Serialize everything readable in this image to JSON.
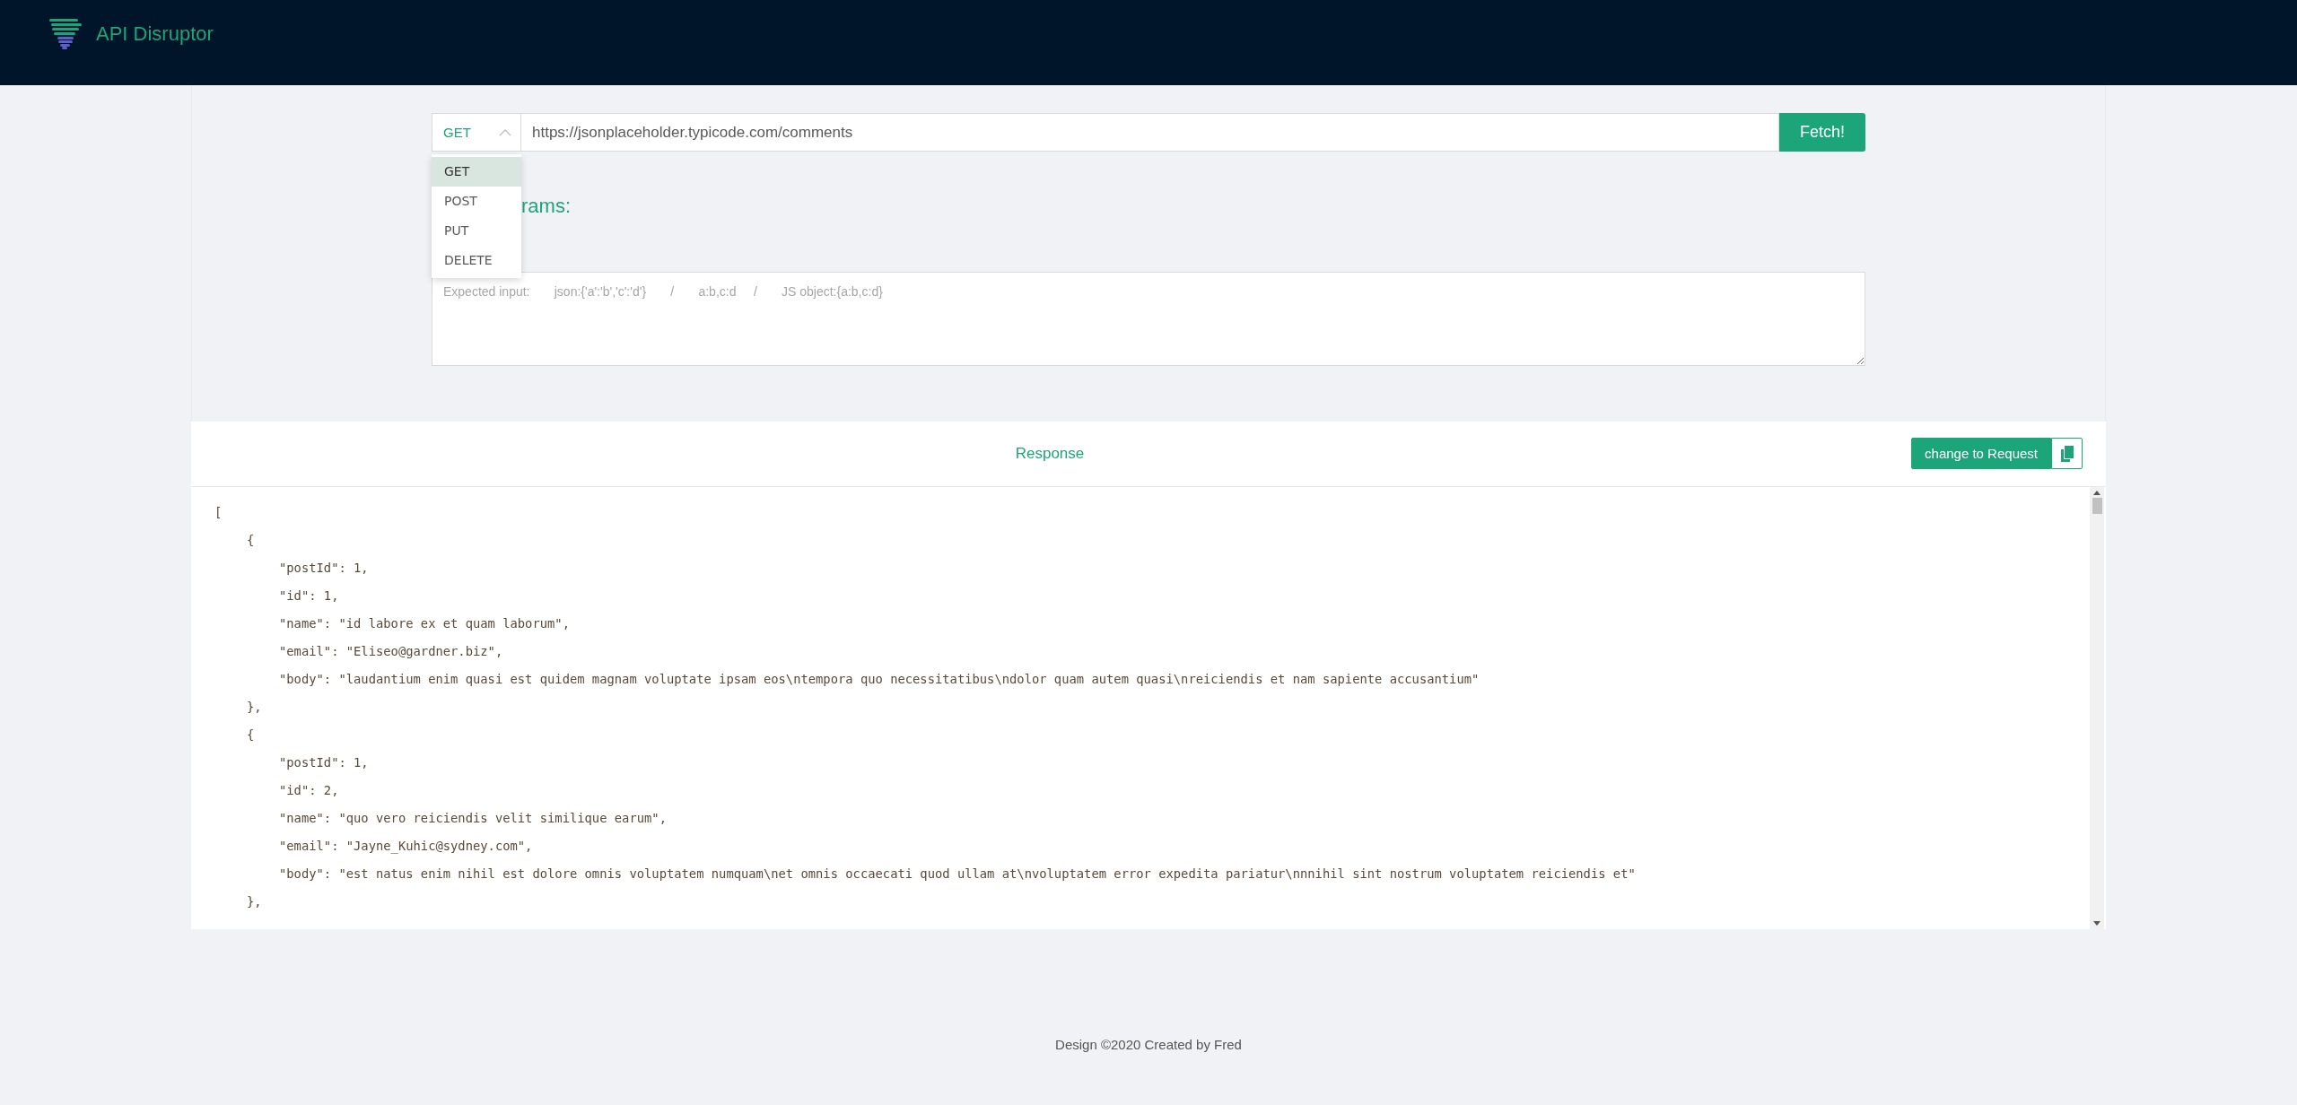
{
  "header": {
    "title": "API Disruptor"
  },
  "request": {
    "method": "GET",
    "url": "https://jsonplaceholder.typicode.com/comments",
    "fetch_button": "Fetch!",
    "method_menu": [
      {
        "label": "GET",
        "selected": true
      },
      {
        "label": "POST",
        "selected": false
      },
      {
        "label": "PUT",
        "selected": false
      },
      {
        "label": "DELETE",
        "selected": false
      }
    ],
    "params_label": "rams:",
    "params_placeholder": "Expected input:       json:{'a':'b','c':'d'}       /       a:b,c:d     /       JS object:{a:b,c:d}"
  },
  "response": {
    "title": "Response",
    "toggle_button": "change to Request",
    "code": [
      {
        "text": "[",
        "children": [
          {
            "text": "{",
            "children": [
              {
                "text": "\"postId\": 1,"
              },
              {
                "text": "\"id\": 1,"
              },
              {
                "text": "\"name\": \"id labore ex et quam laborum\","
              },
              {
                "text": "\"email\": \"Eliseo@gardner.biz\","
              },
              {
                "text": "\"body\": \"laudantium enim quasi est quidem magnam voluptate ipsam eos\\ntempora quo necessitatibus\\ndolor quam autem quasi\\nreiciendis et nam sapiente accusantium\""
              }
            ]
          },
          {
            "text": "},"
          },
          {
            "text": "{",
            "children": [
              {
                "text": "\"postId\": 1,"
              },
              {
                "text": "\"id\": 2,"
              },
              {
                "text": "\"name\": \"quo vero reiciendis velit similique earum\","
              },
              {
                "text": "\"email\": \"Jayne_Kuhic@sydney.com\","
              },
              {
                "text": "\"body\": \"est natus enim nihil est dolore omnis voluptatem numquam\\net omnis occaecati quod ullam at\\nvoluptatem error expedita pariatur\\nnnihil sint nostrum voluptatem reiciendis et\""
              }
            ]
          },
          {
            "text": "},"
          }
        ]
      }
    ]
  },
  "footer": {
    "text": "Design ©2020 Created by Fred"
  }
}
